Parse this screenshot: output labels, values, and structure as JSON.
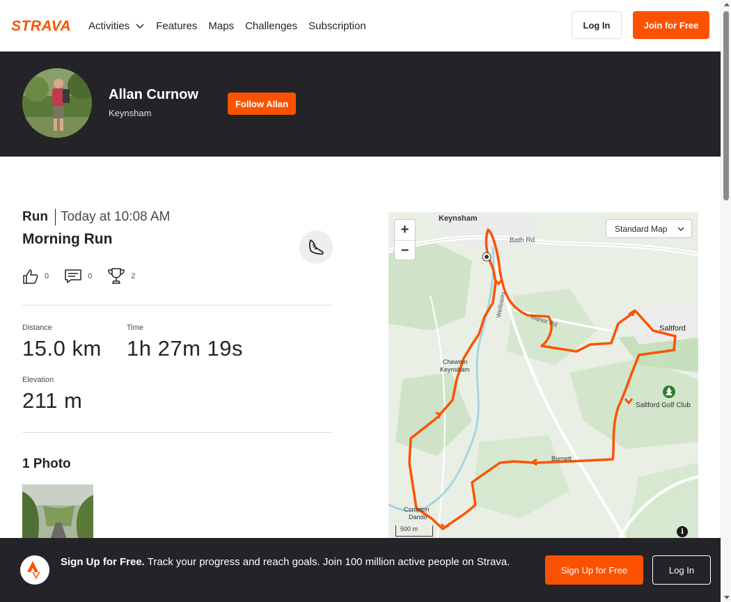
{
  "brand": {
    "logo_text": "STRAVA",
    "accent": "#fc5200"
  },
  "nav": {
    "items": [
      {
        "label": "Activities",
        "has_dropdown": true
      },
      {
        "label": "Features"
      },
      {
        "label": "Maps"
      },
      {
        "label": "Challenges"
      },
      {
        "label": "Subscription"
      }
    ],
    "login_label": "Log In",
    "join_label": "Join for Free"
  },
  "athlete": {
    "name": "Allan Curnow",
    "location": "Keynsham",
    "follow_label": "Follow Allan"
  },
  "activity": {
    "type": "Run",
    "date": "Today at 10:08 AM",
    "title": "Morning Run",
    "kudos_count": "0",
    "comments_count": "0",
    "achievements_count": "2",
    "stats": {
      "distance_label": "Distance",
      "distance_value": "15.0 km",
      "time_label": "Time",
      "time_value": "1h 27m 19s",
      "elevation_label": "Elevation",
      "elevation_value": "211 m"
    },
    "photos_title": "1 Photo"
  },
  "map": {
    "zoom_in": "+",
    "zoom_out": "−",
    "style_select": "Standard Map",
    "scale_label": "500 m",
    "info_label": "i",
    "place_labels": {
      "keynsham": "Keynsham",
      "bath_rd": "Bath Rd",
      "wellsway": "Wellsway",
      "manor_rd": "Manor Rd",
      "saltford": "Saltford",
      "chewton_1": "Chewton",
      "chewton_2": "Keynsham",
      "saltford_golf": "Saltford Golf Club",
      "burnett": "Burnett",
      "compton_1": "Compton",
      "compton_2": "Dando"
    }
  },
  "banner": {
    "headline": "Sign Up for Free.",
    "body": "Track your progress and reach goals. Join 100 million active people on Strava.",
    "signup_label": "Sign Up for Free",
    "login_label": "Log In"
  }
}
